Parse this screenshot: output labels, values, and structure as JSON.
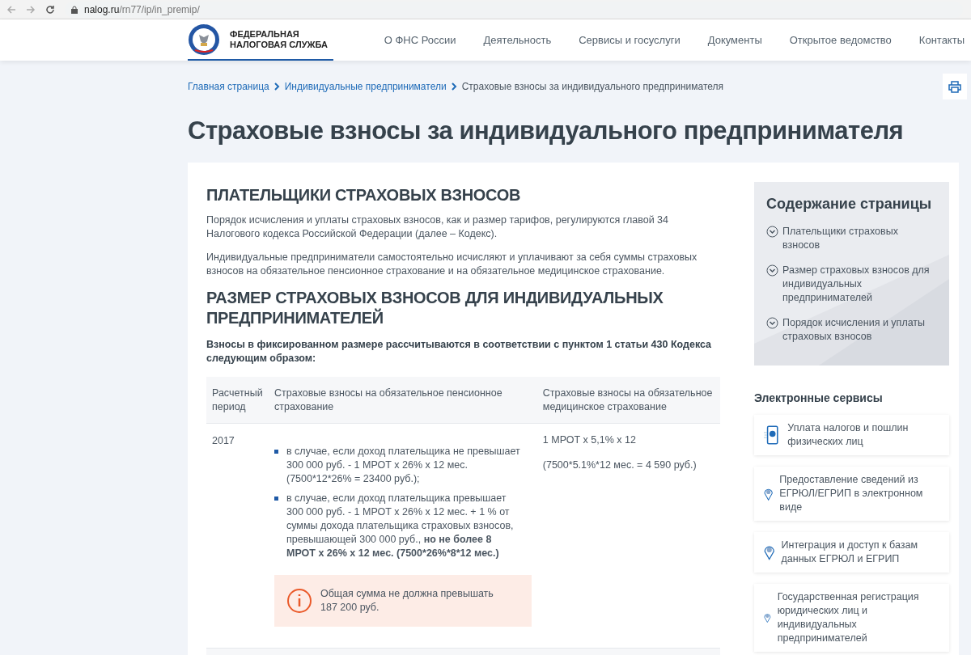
{
  "browser": {
    "url_host": "nalog.ru",
    "url_path": "/rn77/ip/in_premip/"
  },
  "header": {
    "logo_text": [
      "ФЕДЕРАЛЬНАЯ",
      "НАЛОГОВАЯ СЛУЖБА"
    ],
    "nav": [
      "О ФНС России",
      "Деятельность",
      "Сервисы и госуслуги",
      "Документы",
      "Открытое ведомство",
      "Контакты"
    ]
  },
  "breadcrumbs": [
    "Главная страница",
    "Индивидуальные предприниматели",
    "Страховые взносы за индивидуального предпринимателя"
  ],
  "title": "Страховые взносы за индивидуального предпринимателя",
  "content": [
    {
      "kind": "heading",
      "text": "ПЛАТЕЛЬЩИКИ СТРАХОВЫХ ВЗНОСОВ"
    },
    {
      "kind": "paragraph",
      "text": "Порядок исчисления и уплаты страховых взносов, как и размер тарифов, регулируются главой 34 Налогового кодекса Российской Федерации (далее – Кодекс)."
    },
    {
      "kind": "paragraph",
      "text": "Индивидуальные предприниматели самостоятельно исчисляют и уплачивают за себя суммы страховых взносов на обязательное пенсионное страхование и на обязательное медицинское страхование."
    },
    {
      "kind": "heading",
      "text": "РАЗМЕР СТРАХОВЫХ ВЗНОСОВ ДЛЯ ИНДИВИДУАЛЬНЫХ ПРЕДПРИНИМАТЕЛЕЙ"
    },
    {
      "kind": "lead",
      "text": "Взносы в фиксированном размере рассчитываются в соответствии с пунктом 1 статьи 430 Кодекса следующим образом:"
    }
  ],
  "table": {
    "columns": [
      "Расчетный период",
      "Страховые взносы на обязательное пенсионное страхование",
      "Страховые взносы на обязательное медицинское страхование"
    ],
    "rows": [
      {
        "period": "2017",
        "pension_items": [
          "в случае, если доход плательщика не превышает 300 000 руб. - 1 МРОТ х 26% х 12 мес. (7500*12*26% = 23400 руб.);",
          "в случае, если доход плательщика превышает 300 000 руб. - 1 МРОТ х 26% х 12 мес. + 1 % от суммы дохода плательщика страховых взносов, превышающей 300 000 руб., **но не более 8 МРОТ х 26% х 12 мес. (7500*26%*8*12 мес.)**"
        ],
        "pension_notice": "Общая сумма не должна превышать 187 200 руб.",
        "medical": [
          "1 МРОТ х 5,1% х 12",
          "(7500*5.1%*12 мес. = 4 590 руб.)"
        ]
      }
    ]
  },
  "toc": {
    "title": "Содержание страницы",
    "items": [
      "Плательщики страховых взносов",
      "Размер страховых взносов для индивидуальных предпринимателей",
      "Порядок исчисления и уплаты страховых взносов"
    ]
  },
  "services": {
    "title": "Электронные сервисы",
    "items": [
      {
        "kind": "phone",
        "text": "Уплата налогов и пошлин физических лиц"
      },
      {
        "kind": "pin",
        "text": "Предоставление сведений из ЕГРЮЛ/ЕГРИП в электронном виде"
      },
      {
        "kind": "pin",
        "text": "Интеграция и доступ к базам данных ЕГРЮЛ и ЕГРИП"
      },
      {
        "kind": "pin",
        "text": "Государственная регистрация юридических лиц и индивидуальных предпринимателей"
      }
    ]
  }
}
